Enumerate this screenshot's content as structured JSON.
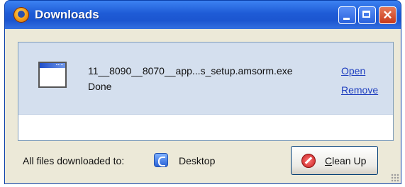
{
  "window": {
    "title": "Downloads"
  },
  "download": {
    "filename": "11__8090__8070__app...s_setup.amsorm.exe",
    "status": "Done",
    "open_label": "Open",
    "remove_label": "Remove"
  },
  "footer": {
    "label": "All files downloaded to:",
    "location": "Desktop",
    "cleanup_label_underlined": "C",
    "cleanup_label_rest": "lean Up"
  },
  "icons": {
    "app": "firefox-icon",
    "file": "application-window-icon",
    "location": "desktop-icon",
    "cleanup": "no-entry-icon"
  },
  "colors": {
    "title_bar": "#1e5bd6",
    "item_bg": "#d4dfee",
    "link": "#1f3fbf"
  }
}
